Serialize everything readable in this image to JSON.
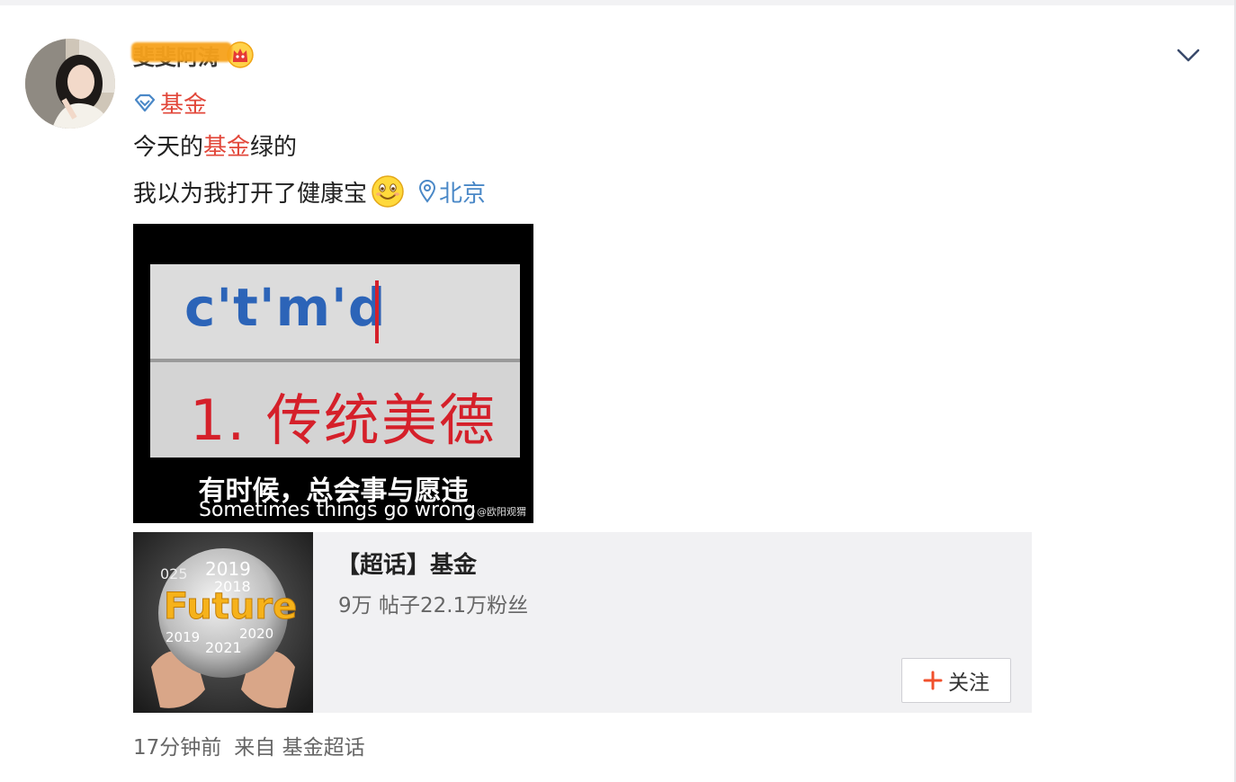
{
  "post": {
    "username": "斐斐阿涛",
    "topic": "基金",
    "text_line1": {
      "before": "今天的",
      "highlight": "基金",
      "after": "绿的"
    },
    "text_line2": "我以为我打开了健康宝",
    "location": "北京"
  },
  "image": {
    "typed_text": "c't'm'd",
    "candidate": "1. 传统美德",
    "caption_cn": "有时候，总会事与愿违",
    "caption_en": "Sometimes things go wrong",
    "watermark": "@欧阳观猬"
  },
  "card": {
    "title": "【超话】基金",
    "stats": "9万 帖子22.1万粉丝",
    "follow_label": "关注",
    "thumb_text": {
      "year1": "2019",
      "year2": "2018",
      "year_left": "025",
      "word": "Future",
      "year3": "2019",
      "year4": "2020",
      "year5": "2021"
    }
  },
  "footer": {
    "time": "17分钟前",
    "source_prefix": "来自",
    "source": "基金超话"
  },
  "colors": {
    "highlight_red": "#e2473a",
    "location_blue": "#4a88c7",
    "card_bg": "#f1f1f3",
    "follow_plus": "#f1502c"
  }
}
